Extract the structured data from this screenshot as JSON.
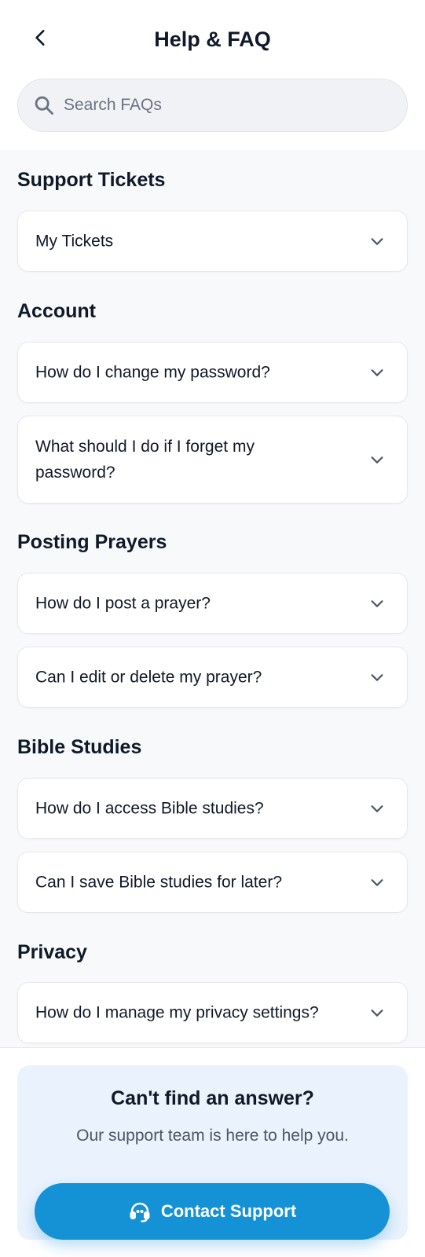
{
  "header": {
    "title": "Help & FAQ",
    "back_icon": "chevron-left-icon"
  },
  "search": {
    "placeholder": "Search FAQs",
    "value": "",
    "icon": "search-icon"
  },
  "sections": [
    {
      "title": "Support Tickets",
      "items": [
        {
          "question": "My Tickets"
        }
      ]
    },
    {
      "title": "Account",
      "items": [
        {
          "question": "How do I change my password?"
        },
        {
          "question": "What should I do if I forget my password?"
        }
      ]
    },
    {
      "title": "Posting Prayers",
      "items": [
        {
          "question": "How do I post a prayer?"
        },
        {
          "question": "Can I edit or delete my prayer?"
        }
      ]
    },
    {
      "title": "Bible Studies",
      "items": [
        {
          "question": "How do I access Bible studies?"
        },
        {
          "question": "Can I save Bible studies for later?"
        }
      ]
    },
    {
      "title": "Privacy",
      "items": [
        {
          "question": "How do I manage my privacy settings?"
        }
      ]
    }
  ],
  "contact": {
    "title": "Can't find an answer?",
    "subtitle": "Our support team is here to help you.",
    "button_label": "Contact Support",
    "button_icon": "headset-icon"
  },
  "colors": {
    "accent": "#1592d5",
    "panel_bg": "#eaf2fd",
    "page_bg": "#f8f9fb",
    "text_primary": "#111827",
    "text_secondary": "#4b5563",
    "icon_gray": "#6b7280"
  }
}
